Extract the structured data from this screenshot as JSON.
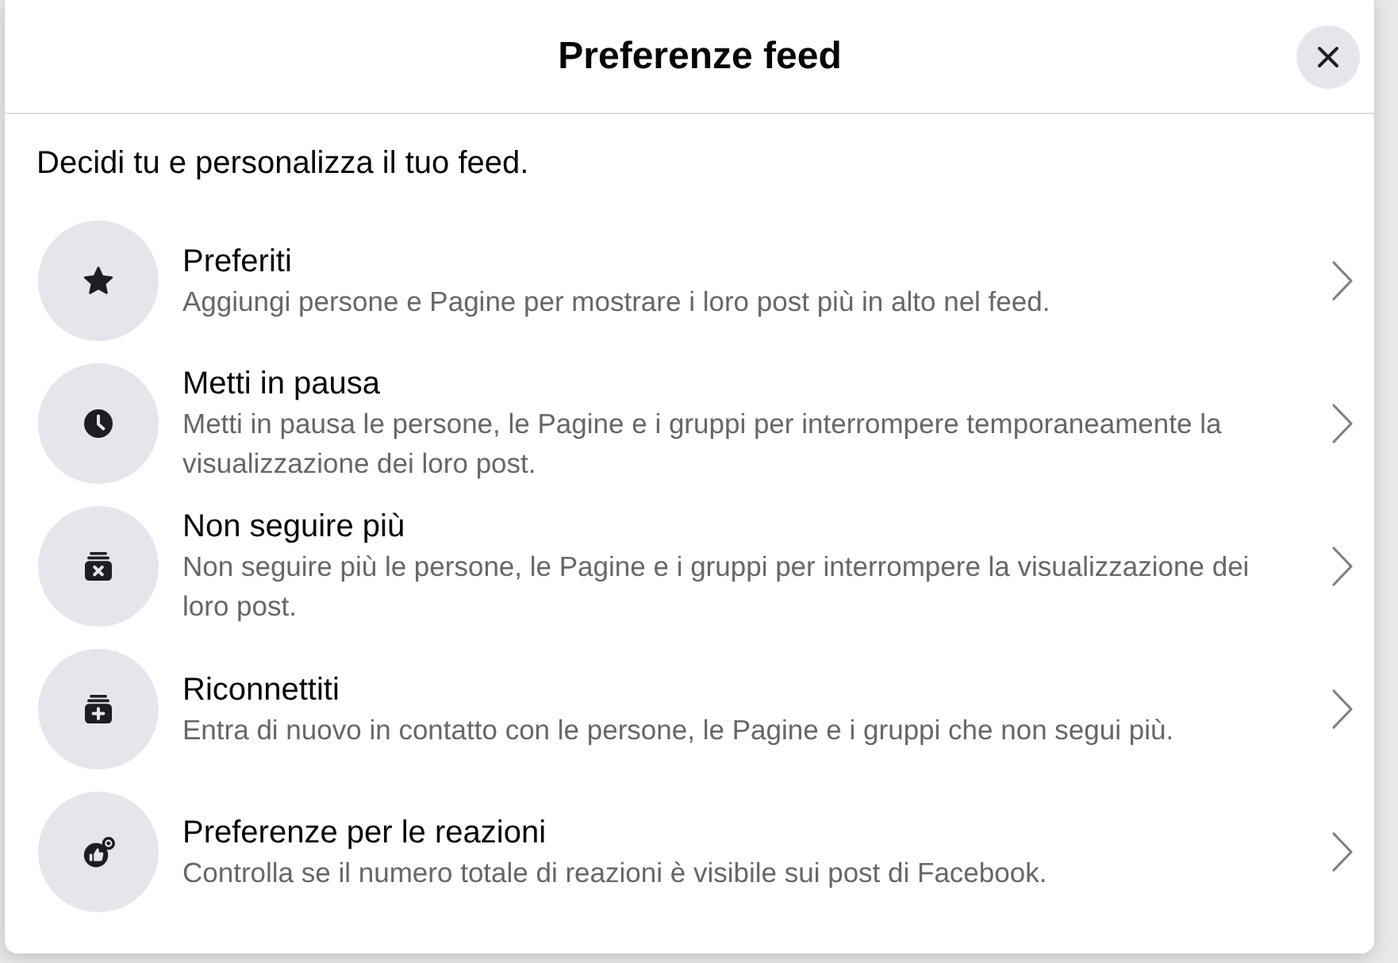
{
  "dialog": {
    "title": "Preferenze feed",
    "close": {
      "kind": "close"
    }
  },
  "intro": "Decidi tu e personalizza il tuo feed.",
  "options": [
    {
      "kind": "star",
      "title": "Preferiti",
      "description": "Aggiungi persone e Pagine per mostrare i loro post più in alto nel feed."
    },
    {
      "kind": "clock",
      "title": "Metti in pausa",
      "description": "Metti in pausa le persone, le Pagine e i gruppi per interrompere temporaneamente la visualizzazione dei loro post."
    },
    {
      "kind": "unfollow",
      "title": "Non seguire più",
      "description": "Non seguire più le persone, le Pagine e i gruppi per interrompere la visualizzazione dei loro post."
    },
    {
      "kind": "reconnect",
      "title": "Riconnettiti",
      "description": "Entra di nuovo in contatto con le persone, le Pagine e i gruppi che non segui più."
    },
    {
      "kind": "reactions",
      "title": "Preferenze per le reazioni",
      "description": "Controlla se il numero totale di reazioni è visibile sui post di Facebook."
    }
  ]
}
